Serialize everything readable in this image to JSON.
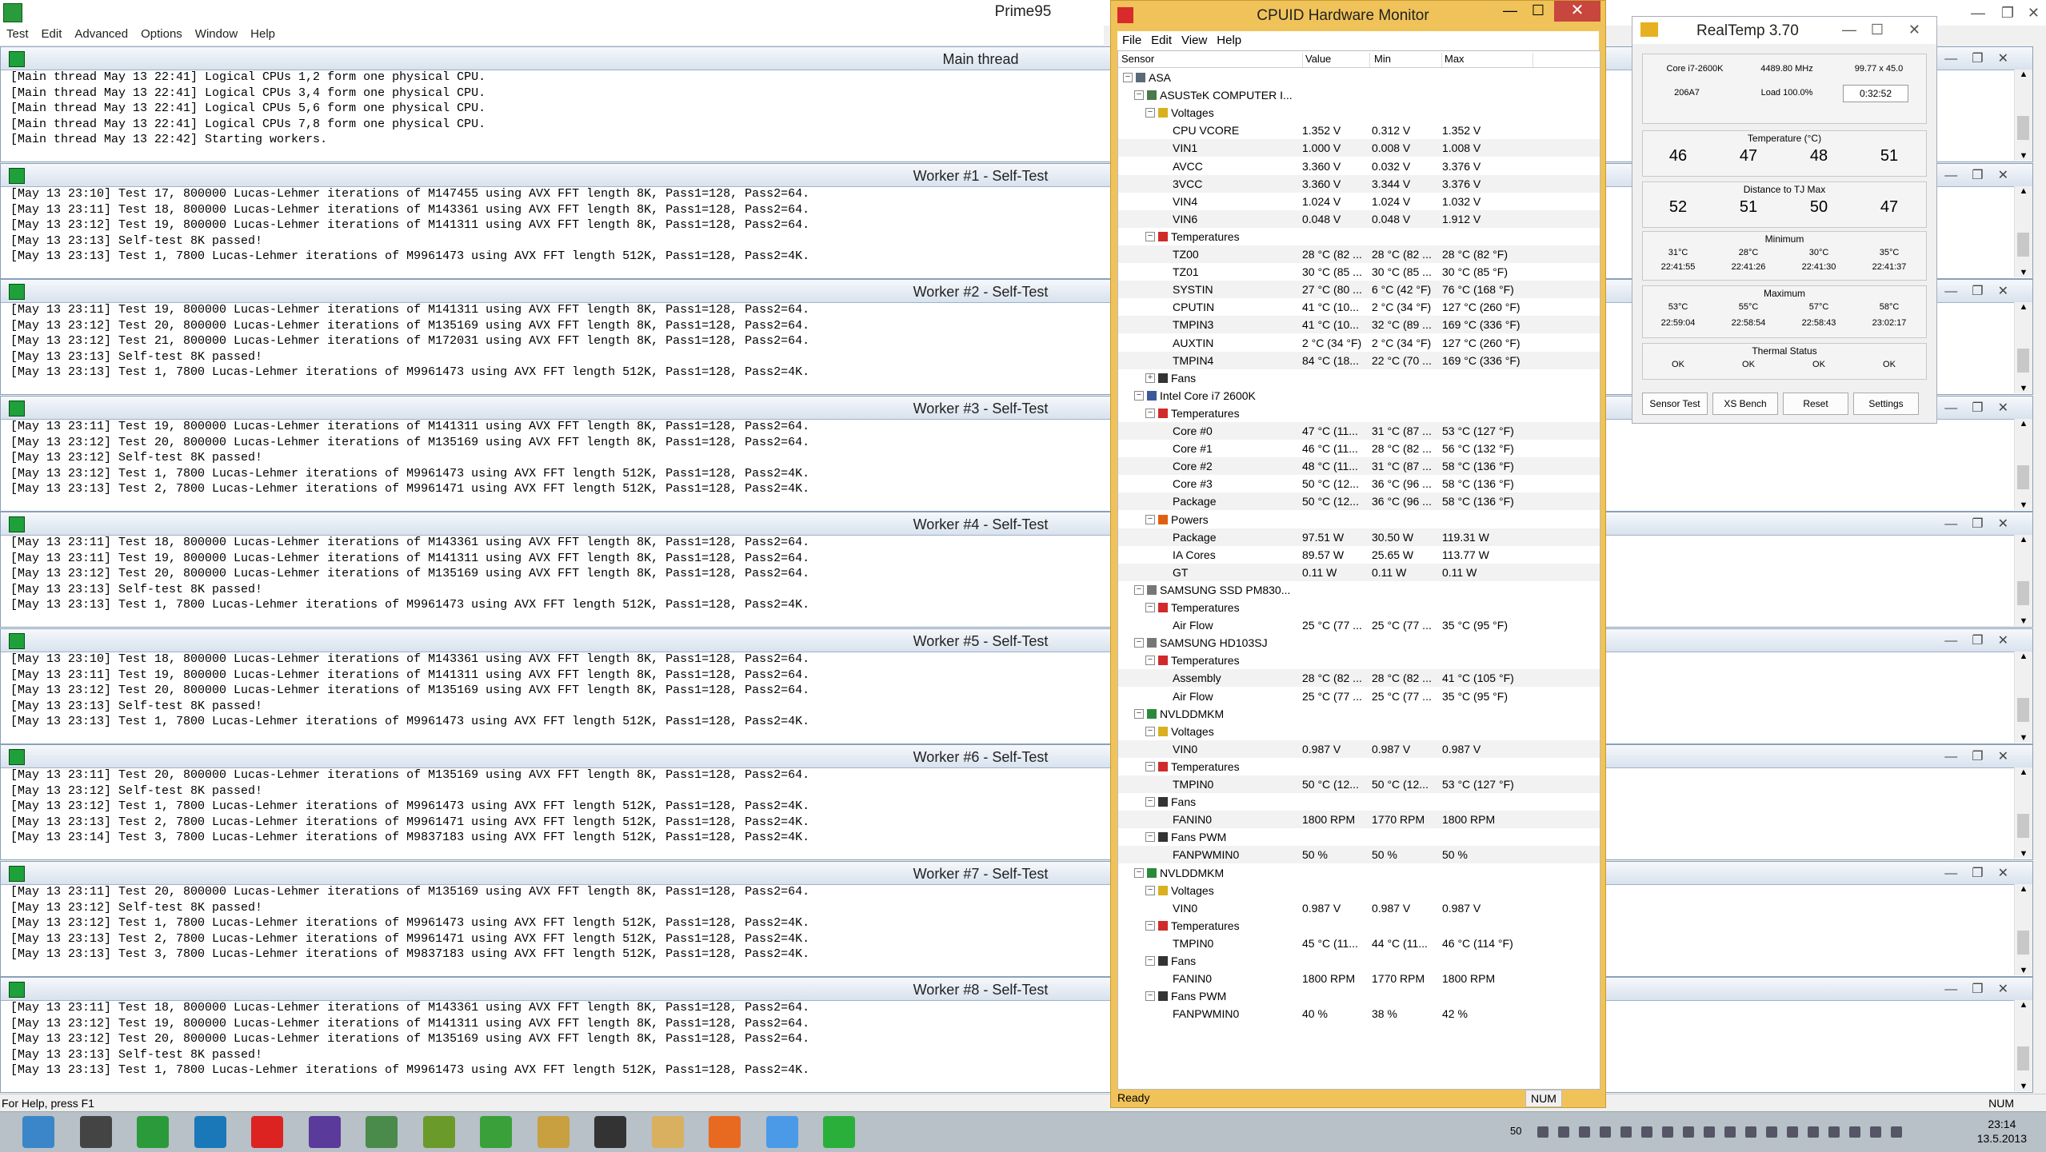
{
  "prime95": {
    "title": "Prime95",
    "menu": [
      "Test",
      "Edit",
      "Advanced",
      "Options",
      "Window",
      "Help"
    ],
    "status": "For Help, press F1",
    "num": "NUM",
    "windows": [
      {
        "title": "Main thread",
        "lines": [
          "[Main thread May 13 22:41] Logical CPUs 1,2 form one physical CPU.",
          "[Main thread May 13 22:41] Logical CPUs 3,4 form one physical CPU.",
          "[Main thread May 13 22:41] Logical CPUs 5,6 form one physical CPU.",
          "[Main thread May 13 22:41] Logical CPUs 7,8 form one physical CPU.",
          "[Main thread May 13 22:42] Starting workers."
        ]
      },
      {
        "title": "Worker #1 - Self-Test",
        "lines": [
          "[May 13 23:10] Test 17, 800000 Lucas-Lehmer iterations of M147455 using AVX FFT length 8K, Pass1=128, Pass2=64.",
          "[May 13 23:11] Test 18, 800000 Lucas-Lehmer iterations of M143361 using AVX FFT length 8K, Pass1=128, Pass2=64.",
          "[May 13 23:12] Test 19, 800000 Lucas-Lehmer iterations of M141311 using AVX FFT length 8K, Pass1=128, Pass2=64.",
          "[May 13 23:13] Self-test 8K passed!",
          "[May 13 23:13] Test 1, 7800 Lucas-Lehmer iterations of M9961473 using AVX FFT length 512K, Pass1=128, Pass2=4K."
        ]
      },
      {
        "title": "Worker #2 - Self-Test",
        "lines": [
          "[May 13 23:11] Test 19, 800000 Lucas-Lehmer iterations of M141311 using AVX FFT length 8K, Pass1=128, Pass2=64.",
          "[May 13 23:12] Test 20, 800000 Lucas-Lehmer iterations of M135169 using AVX FFT length 8K, Pass1=128, Pass2=64.",
          "[May 13 23:12] Test 21, 800000 Lucas-Lehmer iterations of M172031 using AVX FFT length 8K, Pass1=128, Pass2=64.",
          "[May 13 23:13] Self-test 8K passed!",
          "[May 13 23:13] Test 1, 7800 Lucas-Lehmer iterations of M9961473 using AVX FFT length 512K, Pass1=128, Pass2=4K."
        ]
      },
      {
        "title": "Worker #3 - Self-Test",
        "lines": [
          "[May 13 23:11] Test 19, 800000 Lucas-Lehmer iterations of M141311 using AVX FFT length 8K, Pass1=128, Pass2=64.",
          "[May 13 23:12] Test 20, 800000 Lucas-Lehmer iterations of M135169 using AVX FFT length 8K, Pass1=128, Pass2=64.",
          "[May 13 23:12] Self-test 8K passed!",
          "[May 13 23:12] Test 1, 7800 Lucas-Lehmer iterations of M9961473 using AVX FFT length 512K, Pass1=128, Pass2=4K.",
          "[May 13 23:13] Test 2, 7800 Lucas-Lehmer iterations of M9961471 using AVX FFT length 512K, Pass1=128, Pass2=4K."
        ]
      },
      {
        "title": "Worker #4 - Self-Test",
        "lines": [
          "[May 13 23:11] Test 18, 800000 Lucas-Lehmer iterations of M143361 using AVX FFT length 8K, Pass1=128, Pass2=64.",
          "[May 13 23:11] Test 19, 800000 Lucas-Lehmer iterations of M141311 using AVX FFT length 8K, Pass1=128, Pass2=64.",
          "[May 13 23:12] Test 20, 800000 Lucas-Lehmer iterations of M135169 using AVX FFT length 8K, Pass1=128, Pass2=64.",
          "[May 13 23:13] Self-test 8K passed!",
          "[May 13 23:13] Test 1, 7800 Lucas-Lehmer iterations of M9961473 using AVX FFT length 512K, Pass1=128, Pass2=4K."
        ]
      },
      {
        "title": "Worker #5 - Self-Test",
        "lines": [
          "[May 13 23:10] Test 18, 800000 Lucas-Lehmer iterations of M143361 using AVX FFT length 8K, Pass1=128, Pass2=64.",
          "[May 13 23:11] Test 19, 800000 Lucas-Lehmer iterations of M141311 using AVX FFT length 8K, Pass1=128, Pass2=64.",
          "[May 13 23:12] Test 20, 800000 Lucas-Lehmer iterations of M135169 using AVX FFT length 8K, Pass1=128, Pass2=64.",
          "[May 13 23:13] Self-test 8K passed!",
          "[May 13 23:13] Test 1, 7800 Lucas-Lehmer iterations of M9961473 using AVX FFT length 512K, Pass1=128, Pass2=4K."
        ]
      },
      {
        "title": "Worker #6 - Self-Test",
        "lines": [
          "[May 13 23:11] Test 20, 800000 Lucas-Lehmer iterations of M135169 using AVX FFT length 8K, Pass1=128, Pass2=64.",
          "[May 13 23:12] Self-test 8K passed!",
          "[May 13 23:12] Test 1, 7800 Lucas-Lehmer iterations of M9961473 using AVX FFT length 512K, Pass1=128, Pass2=4K.",
          "[May 13 23:13] Test 2, 7800 Lucas-Lehmer iterations of M9961471 using AVX FFT length 512K, Pass1=128, Pass2=4K.",
          "[May 13 23:14] Test 3, 7800 Lucas-Lehmer iterations of M9837183 using AVX FFT length 512K, Pass1=128, Pass2=4K."
        ]
      },
      {
        "title": "Worker #7 - Self-Test",
        "lines": [
          "[May 13 23:11] Test 20, 800000 Lucas-Lehmer iterations of M135169 using AVX FFT length 8K, Pass1=128, Pass2=64.",
          "[May 13 23:12] Self-test 8K passed!",
          "[May 13 23:12] Test 1, 7800 Lucas-Lehmer iterations of M9961473 using AVX FFT length 512K, Pass1=128, Pass2=4K.",
          "[May 13 23:13] Test 2, 7800 Lucas-Lehmer iterations of M9961471 using AVX FFT length 512K, Pass1=128, Pass2=4K.",
          "[May 13 23:13] Test 3, 7800 Lucas-Lehmer iterations of M9837183 using AVX FFT length 512K, Pass1=128, Pass2=4K."
        ]
      },
      {
        "title": "Worker #8 - Self-Test",
        "lines": [
          "[May 13 23:11] Test 18, 800000 Lucas-Lehmer iterations of M143361 using AVX FFT length 8K, Pass1=128, Pass2=64.",
          "[May 13 23:12] Test 19, 800000 Lucas-Lehmer iterations of M141311 using AVX FFT length 8K, Pass1=128, Pass2=64.",
          "[May 13 23:12] Test 20, 800000 Lucas-Lehmer iterations of M135169 using AVX FFT length 8K, Pass1=128, Pass2=64.",
          "[May 13 23:13] Self-test 8K passed!",
          "[May 13 23:13] Test 1, 7800 Lucas-Lehmer iterations of M9961473 using AVX FFT length 512K, Pass1=128, Pass2=4K."
        ]
      }
    ]
  },
  "hwmonitor": {
    "title": "CPUID Hardware Monitor",
    "menu": [
      "File",
      "Edit",
      "View",
      "Help"
    ],
    "columns": {
      "sensor": "Sensor",
      "value": "Value",
      "min": "Min",
      "max": "Max"
    },
    "status": "Ready",
    "num": "NUM",
    "rows": [
      {
        "level": 0,
        "label": "ASA",
        "icon": "computer-icon"
      },
      {
        "level": 1,
        "label": "ASUSTeK COMPUTER I...",
        "icon": "motherboard-icon"
      },
      {
        "level": 2,
        "label": "Voltages",
        "icon": "voltage-icon"
      },
      {
        "level": 3,
        "label": "CPU VCORE",
        "value": "1.352 V",
        "min": "0.312 V",
        "max": "1.352 V"
      },
      {
        "level": 3,
        "label": "VIN1",
        "value": "1.000 V",
        "min": "0.008 V",
        "max": "1.008 V"
      },
      {
        "level": 3,
        "label": "AVCC",
        "value": "3.360 V",
        "min": "0.032 V",
        "max": "3.376 V"
      },
      {
        "level": 3,
        "label": "3VCC",
        "value": "3.360 V",
        "min": "3.344 V",
        "max": "3.376 V"
      },
      {
        "level": 3,
        "label": "VIN4",
        "value": "1.024 V",
        "min": "1.024 V",
        "max": "1.032 V"
      },
      {
        "level": 3,
        "label": "VIN6",
        "value": "0.048 V",
        "min": "0.048 V",
        "max": "1.912 V"
      },
      {
        "level": 2,
        "label": "Temperatures",
        "icon": "thermometer-icon"
      },
      {
        "level": 3,
        "label": "TZ00",
        "value": "28 °C (82 ...",
        "min": "28 °C (82 ...",
        "max": "28 °C (82 °F)"
      },
      {
        "level": 3,
        "label": "TZ01",
        "value": "30 °C (85 ...",
        "min": "30 °C (85 ...",
        "max": "30 °C (85 °F)"
      },
      {
        "level": 3,
        "label": "SYSTIN",
        "value": "27 °C (80 ...",
        "min": "6 °C (42 °F)",
        "max": "76 °C (168 °F)"
      },
      {
        "level": 3,
        "label": "CPUTIN",
        "value": "41 °C (10...",
        "min": "2 °C (34 °F)",
        "max": "127 °C (260 °F)"
      },
      {
        "level": 3,
        "label": "TMPIN3",
        "value": "41 °C (10...",
        "min": "32 °C (89 ...",
        "max": "169 °C (336 °F)"
      },
      {
        "level": 3,
        "label": "AUXTIN",
        "value": "2 °C (34 °F)",
        "min": "2 °C (34 °F)",
        "max": "127 °C (260 °F)"
      },
      {
        "level": 3,
        "label": "TMPIN4",
        "value": "84 °C (18...",
        "min": "22 °C (70 ...",
        "max": "169 °C (336 °F)"
      },
      {
        "level": 2,
        "label": "Fans",
        "icon": "fan-icon",
        "collapsed": true
      },
      {
        "level": 1,
        "label": "Intel Core i7 2600K",
        "icon": "cpu-icon"
      },
      {
        "level": 2,
        "label": "Temperatures",
        "icon": "thermometer-icon"
      },
      {
        "level": 3,
        "label": "Core #0",
        "value": "47 °C (11...",
        "min": "31 °C (87 ...",
        "max": "53 °C (127 °F)"
      },
      {
        "level": 3,
        "label": "Core #1",
        "value": "46 °C (11...",
        "min": "28 °C (82 ...",
        "max": "56 °C (132 °F)"
      },
      {
        "level": 3,
        "label": "Core #2",
        "value": "48 °C (11...",
        "min": "31 °C (87 ...",
        "max": "58 °C (136 °F)"
      },
      {
        "level": 3,
        "label": "Core #3",
        "value": "50 °C (12...",
        "min": "36 °C (96 ...",
        "max": "58 °C (136 °F)"
      },
      {
        "level": 3,
        "label": "Package",
        "value": "50 °C (12...",
        "min": "36 °C (96 ...",
        "max": "58 °C (136 °F)"
      },
      {
        "level": 2,
        "label": "Powers",
        "icon": "power-icon"
      },
      {
        "level": 3,
        "label": "Package",
        "value": "97.51 W",
        "min": "30.50 W",
        "max": "119.31 W"
      },
      {
        "level": 3,
        "label": "IA Cores",
        "value": "89.57 W",
        "min": "25.65 W",
        "max": "113.77 W"
      },
      {
        "level": 3,
        "label": "GT",
        "value": "0.11 W",
        "min": "0.11 W",
        "max": "0.11 W"
      },
      {
        "level": 1,
        "label": "SAMSUNG SSD PM830...",
        "icon": "disk-icon"
      },
      {
        "level": 2,
        "label": "Temperatures",
        "icon": "thermometer-icon"
      },
      {
        "level": 3,
        "label": "Air Flow",
        "value": "25 °C (77 ...",
        "min": "25 °C (77 ...",
        "max": "35 °C (95 °F)"
      },
      {
        "level": 1,
        "label": "SAMSUNG HD103SJ",
        "icon": "disk-icon"
      },
      {
        "level": 2,
        "label": "Temperatures",
        "icon": "thermometer-icon"
      },
      {
        "level": 3,
        "label": "Assembly",
        "value": "28 °C (82 ...",
        "min": "28 °C (82 ...",
        "max": "41 °C (105 °F)"
      },
      {
        "level": 3,
        "label": "Air Flow",
        "value": "25 °C (77 ...",
        "min": "25 °C (77 ...",
        "max": "35 °C (95 °F)"
      },
      {
        "level": 1,
        "label": "NVLDDMKM",
        "icon": "gpu-icon"
      },
      {
        "level": 2,
        "label": "Voltages",
        "icon": "voltage-icon"
      },
      {
        "level": 3,
        "label": "VIN0",
        "value": "0.987 V",
        "min": "0.987 V",
        "max": "0.987 V"
      },
      {
        "level": 2,
        "label": "Temperatures",
        "icon": "thermometer-icon"
      },
      {
        "level": 3,
        "label": "TMPIN0",
        "value": "50 °C (12...",
        "min": "50 °C (12...",
        "max": "53 °C (127 °F)"
      },
      {
        "level": 2,
        "label": "Fans",
        "icon": "fan-icon"
      },
      {
        "level": 3,
        "label": "FANIN0",
        "value": "1800 RPM",
        "min": "1770 RPM",
        "max": "1800 RPM"
      },
      {
        "level": 2,
        "label": "Fans PWM",
        "icon": "fan-icon"
      },
      {
        "level": 3,
        "label": "FANPWMIN0",
        "value": "50 %",
        "min": "50 %",
        "max": "50 %"
      },
      {
        "level": 1,
        "label": "NVLDDMKM",
        "icon": "gpu-icon"
      },
      {
        "level": 2,
        "label": "Voltages",
        "icon": "voltage-icon"
      },
      {
        "level": 3,
        "label": "VIN0",
        "value": "0.987 V",
        "min": "0.987 V",
        "max": "0.987 V"
      },
      {
        "level": 2,
        "label": "Temperatures",
        "icon": "thermometer-icon"
      },
      {
        "level": 3,
        "label": "TMPIN0",
        "value": "45 °C (11...",
        "min": "44 °C (11...",
        "max": "46 °C (114 °F)"
      },
      {
        "level": 2,
        "label": "Fans",
        "icon": "fan-icon"
      },
      {
        "level": 3,
        "label": "FANIN0",
        "value": "1800 RPM",
        "min": "1770 RPM",
        "max": "1800 RPM"
      },
      {
        "level": 2,
        "label": "Fans PWM",
        "icon": "fan-icon"
      },
      {
        "level": 3,
        "label": "FANPWMIN0",
        "value": "40 %",
        "min": "38 %",
        "max": "42 %"
      }
    ]
  },
  "realtemp": {
    "title": "RealTemp 3.70",
    "cpu": "Core i7-2600K",
    "freq": "4489.80 MHz",
    "mult": "99.77 x 45.0",
    "stepping": "206A7",
    "load": "Load 100.0%",
    "timer": "0:32:52",
    "temp_heading": "Temperature (°C)",
    "temps": [
      "46",
      "47",
      "48",
      "51"
    ],
    "tj_heading": "Distance to TJ Max",
    "tj": [
      "52",
      "51",
      "50",
      "47"
    ],
    "min_heading": "Minimum",
    "min_temps": [
      "31°C",
      "28°C",
      "30°C",
      "35°C"
    ],
    "min_times": [
      "22:41:55",
      "22:41:26",
      "22:41:30",
      "22:41:37"
    ],
    "max_heading": "Maximum",
    "max_temps": [
      "53°C",
      "55°C",
      "57°C",
      "58°C"
    ],
    "max_times": [
      "22:59:04",
      "22:58:54",
      "22:58:43",
      "23:02:17"
    ],
    "thermal_heading": "Thermal Status",
    "thermal": [
      "OK",
      "OK",
      "OK",
      "OK"
    ],
    "buttons": [
      "Sensor Test",
      "XS Bench",
      "Reset",
      "Settings"
    ]
  },
  "taskbar": {
    "apps": [
      "computer-icon",
      "winamp-icon",
      "network-icon",
      "taskmanager-icon",
      "hwmonitor-icon",
      "cpuz-icon",
      "chart-icon",
      "xbox-icon",
      "utorrent-icon",
      "realtemp-icon",
      "fan-icon",
      "explorer-icon",
      "firefox-icon",
      "chrome-icon",
      "prime95-icon"
    ],
    "tray_num": "50",
    "time": "23:14",
    "date": "13.5.2013"
  }
}
